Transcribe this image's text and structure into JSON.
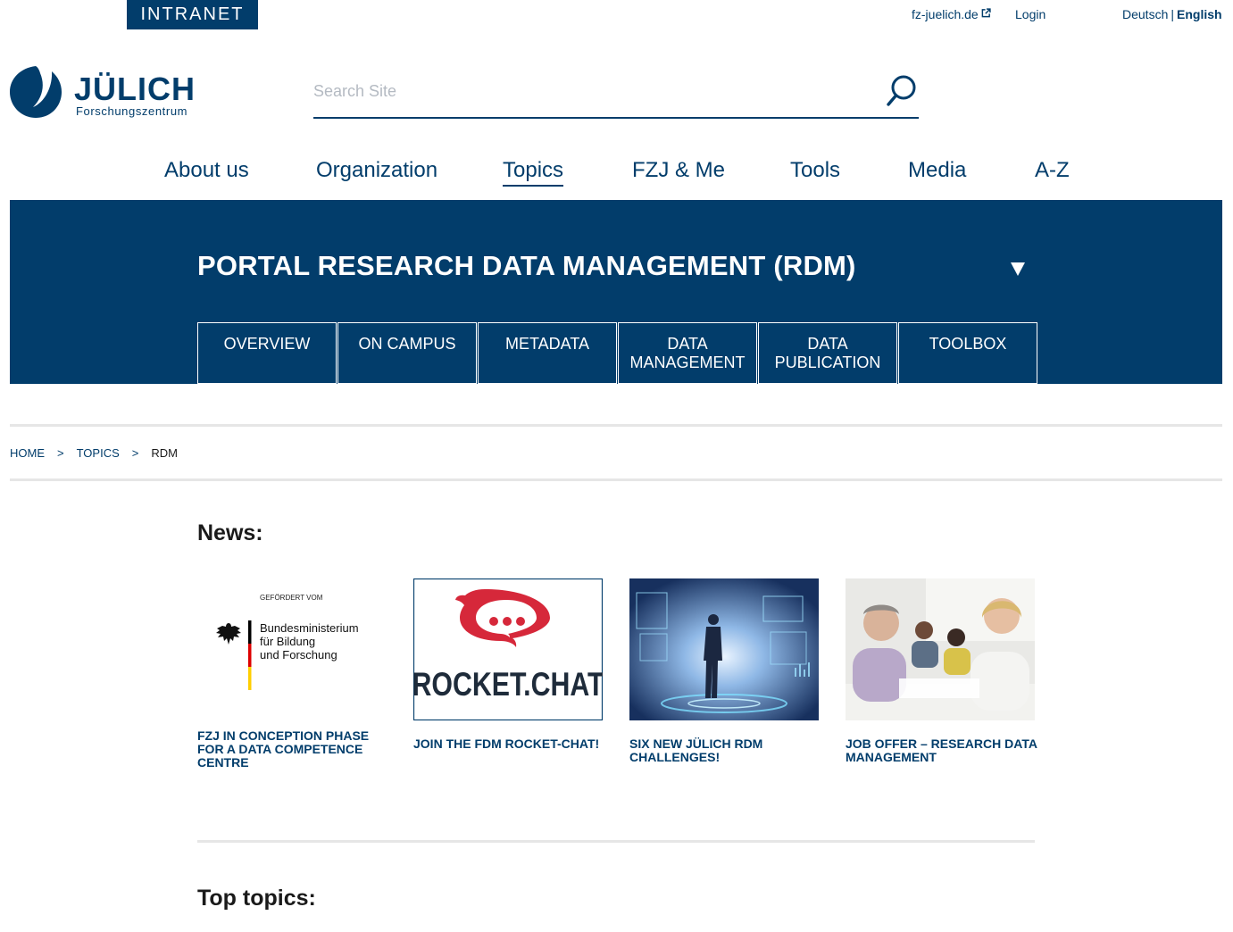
{
  "header": {
    "intranet_label": "INTRANET",
    "external_link": "fz-juelich.de",
    "login_label": "Login",
    "lang_de": "Deutsch",
    "lang_separator": "|",
    "lang_en": "English",
    "logo_name": "JÜLICH",
    "logo_subtitle": "Forschungszentrum"
  },
  "search": {
    "placeholder": "Search Site",
    "value": ""
  },
  "main_nav": [
    {
      "label": "About us",
      "active": false
    },
    {
      "label": "Organization",
      "active": false
    },
    {
      "label": "Topics",
      "active": true
    },
    {
      "label": "FZJ & Me",
      "active": false
    },
    {
      "label": "Tools",
      "active": false
    },
    {
      "label": "Media",
      "active": false
    },
    {
      "label": "A-Z",
      "active": false
    }
  ],
  "banner": {
    "title": "PORTAL RESEARCH DATA MANAGEMENT (RDM)",
    "tabs": [
      {
        "line1": "OVERVIEW",
        "line2": ""
      },
      {
        "line1": "ON CAMPUS",
        "line2": ""
      },
      {
        "line1": "METADATA",
        "line2": ""
      },
      {
        "line1": "DATA",
        "line2": "MANAGEMENT"
      },
      {
        "line1": "DATA",
        "line2": "PUBLICATION"
      },
      {
        "line1": "TOOLBOX",
        "line2": ""
      }
    ]
  },
  "breadcrumb": {
    "home": "HOME",
    "separator": ">",
    "topics": "TOPICS",
    "current": "RDM"
  },
  "news": {
    "heading": "News:",
    "items": [
      {
        "title": "FZJ IN CONCEPTION PHASE FOR A DATA COMPETENCE CENTRE",
        "image_caption_top": "GEFÖRDERT VOM",
        "image_lines": [
          "Bundesministerium",
          "für Bildung",
          "und Forschung"
        ]
      },
      {
        "title": "JOIN THE FDM ROCKET-CHAT!",
        "image_text": "ROCKET.CHAT"
      },
      {
        "title": "SIX NEW JÜLICH RDM CHALLENGES!"
      },
      {
        "title": "JOB OFFER – RESEARCH DATA MANAGEMENT"
      }
    ]
  },
  "top_topics": {
    "heading": "Top topics:"
  },
  "colors": {
    "brand_blue": "#023d6b",
    "divider": "#e6e6e6",
    "rocket_red": "#d6283a"
  }
}
